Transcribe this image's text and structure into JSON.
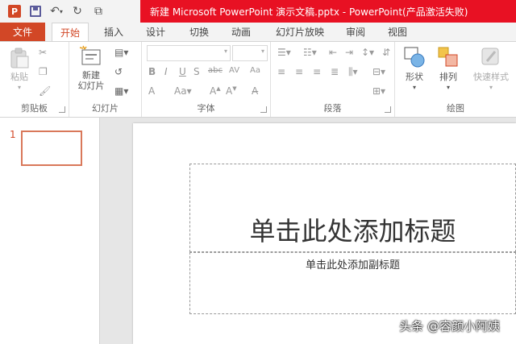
{
  "titlebar": {
    "app_icon": "P",
    "title": "新建 Microsoft PowerPoint 演示文稿.pptx - PowerPoint(产品激活失败)",
    "qat_icons": [
      "powerpoint-icon",
      "save-icon",
      "undo-icon",
      "redo-icon",
      "start-from-beginning-icon"
    ]
  },
  "tabs": {
    "file": "文件",
    "items": [
      "开始",
      "插入",
      "设计",
      "切换",
      "动画",
      "幻灯片放映",
      "审阅",
      "视图"
    ],
    "active": "开始"
  },
  "ribbon": {
    "clipboard": {
      "label": "剪贴板",
      "paste": "粘贴"
    },
    "slides": {
      "label": "幻灯片",
      "new_slide_line1": "新建",
      "new_slide_line2": "幻灯片"
    },
    "font": {
      "label": "字体"
    },
    "paragraph": {
      "label": "段落"
    },
    "drawing": {
      "label": "绘图",
      "shapes": "形状",
      "arrange": "排列",
      "quick_styles": "快速样式"
    }
  },
  "thumbnails": {
    "slide_number": "1"
  },
  "slide": {
    "title_placeholder": "单击此处添加标题",
    "subtitle_placeholder": "单击此处添加副标题"
  },
  "watermark": "头条 @容颜小阿姨",
  "colors": {
    "accent": "#d24726",
    "title_red": "#e81123"
  }
}
